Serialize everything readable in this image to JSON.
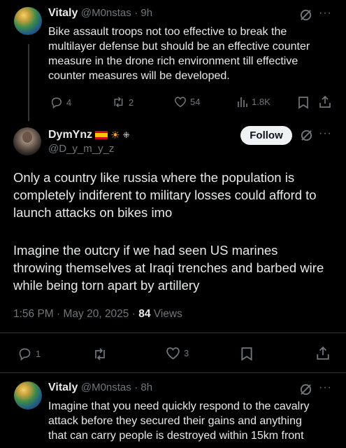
{
  "tweet1": {
    "name": "Vitaly",
    "handle": "@M0nstas",
    "time": "· 9h",
    "text_lines": [
      "Bike assault troops not too effective to break the",
      "multilayer defense but should be an effective counter",
      "measure in the drone rich environment till effective",
      "counter measures will be developed."
    ],
    "replies": "4",
    "reposts": "2",
    "likes": "54",
    "views": "1.8K"
  },
  "main_tweet": {
    "name": "DymYnz",
    "handle": "@D_y_m_y_z",
    "follow_label": "Follow",
    "para1": [
      "Only a country like russia where the population is",
      "completely indiferent to military losses could afford to",
      "launch attacks on bikes imo"
    ],
    "para2": [
      "Imagine the outcry if we had seen US marines",
      "throwing themselves at Iraqi trenches and barbed wire",
      "while being torn apart by artillery"
    ],
    "timestamp": "1:56 PM · May 20, 2025 ·",
    "views_count": "84",
    "views_label": "Views",
    "replies": "1",
    "likes": "3"
  },
  "tweet3": {
    "name": "Vitaly",
    "handle": "@M0nstas",
    "time": "· 8h",
    "text_lines": [
      "Imagine that you need quickly respond to the cavalry",
      "attack before they secured their gains and anything",
      "that can carry people is destroyed within 15km front"
    ]
  },
  "icons": {
    "more": "more-icon",
    "grok": "grok-icon",
    "reply": "reply-icon",
    "repost": "repost-icon",
    "like": "like-icon",
    "views": "views-icon",
    "bookmark": "bookmark-icon",
    "share": "share-icon"
  }
}
